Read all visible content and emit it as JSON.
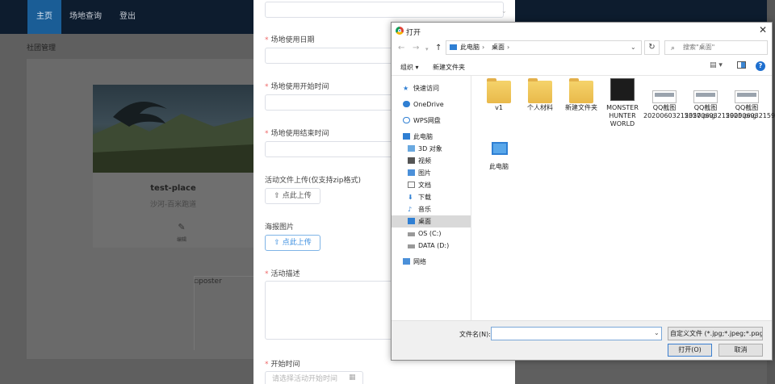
{
  "app": {
    "nav": {
      "home": "主页",
      "venue_query": "场地查询",
      "logout": "登出"
    },
    "breadcrumb": "社团管理",
    "card": {
      "title": "test-place",
      "subtitle": "沙河-百米跑道",
      "edit_label": "编辑"
    },
    "poster_alt": "poster"
  },
  "form": {
    "date_label": "场地使用日期",
    "start_label": "场地使用开始时间",
    "end_label": "场地使用结束时间",
    "file_label": "活动文件上传(仅支持zip格式)",
    "file_upload": "点此上传",
    "poster_label": "海报图片",
    "poster_upload": "点此上传",
    "desc_label": "活动描述",
    "start_time_label": "开始时间",
    "start_time_placeholder": "请选择活动开始时间"
  },
  "dialog": {
    "title": "打开",
    "address": {
      "part1": "此电脑",
      "part2": "桌面"
    },
    "search_placeholder": "搜索\"桌面\"",
    "toolbar": {
      "organize": "组织 ▾",
      "new_folder": "新建文件夹"
    },
    "nav_items": [
      {
        "label": "快速访问",
        "icon": "star-icon"
      },
      {
        "label": "OneDrive",
        "icon": "cloud-icon"
      },
      {
        "label": "WPS网盘",
        "icon": "cloud-outline-icon"
      },
      {
        "label": "此电脑",
        "icon": "computer-icon"
      },
      {
        "label": "3D 对象",
        "icon": "cube-icon"
      },
      {
        "label": "视频",
        "icon": "video-icon"
      },
      {
        "label": "图片",
        "icon": "picture-icon"
      },
      {
        "label": "文档",
        "icon": "document-icon"
      },
      {
        "label": "下载",
        "icon": "download-icon"
      },
      {
        "label": "音乐",
        "icon": "music-icon"
      },
      {
        "label": "桌面",
        "icon": "desktop-icon"
      },
      {
        "label": "OS (C:)",
        "icon": "drive-icon"
      },
      {
        "label": "DATA (D:)",
        "icon": "drive-icon"
      },
      {
        "label": "网络",
        "icon": "network-icon"
      }
    ],
    "files": [
      {
        "name": "v1",
        "type": "folder"
      },
      {
        "name": "个人材料",
        "type": "folder"
      },
      {
        "name": "新建文件夹",
        "type": "folder"
      },
      {
        "name": "MONSTER HUNTER WORLD",
        "type": "shortcut"
      },
      {
        "name": "QQ截图20200603215357.png",
        "type": "image"
      },
      {
        "name": "QQ截图20200603215905.png",
        "type": "image"
      },
      {
        "name": "QQ截图20200603215947.png",
        "type": "image"
      },
      {
        "name": "此电脑",
        "type": "computer"
      }
    ],
    "file_name_label": "文件名(N):",
    "file_name_value": "",
    "filter": "自定义文件 (*.jpg;*.jpeg;*.png)",
    "open_button": "打开(O)",
    "cancel_button": "取消"
  }
}
